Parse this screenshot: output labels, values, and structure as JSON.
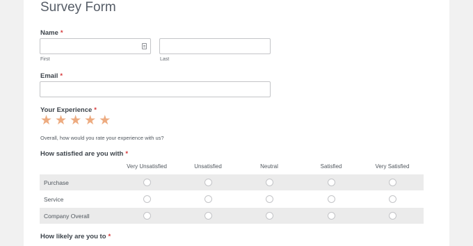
{
  "form": {
    "title": "Survey Form",
    "required_mark": "*",
    "name": {
      "label": "Name",
      "first_sublabel": "First",
      "last_sublabel": "Last",
      "first_value": "",
      "last_value": ""
    },
    "email": {
      "label": "Email",
      "value": ""
    },
    "experience": {
      "label": "Your Experience",
      "rating_max": 5,
      "star_color": "#edab80",
      "description": "Overall, how would you rate your experience with us?"
    },
    "satisfaction": {
      "label": "How satisfied are you with",
      "columns": [
        "Very Unsatisfied",
        "Unsatisfied",
        "Neutral",
        "Satisfied",
        "Very Satisfied"
      ],
      "rows": [
        "Purchase",
        "Service",
        "Company Overall"
      ]
    },
    "likely": {
      "label": "How likely are you to"
    }
  }
}
